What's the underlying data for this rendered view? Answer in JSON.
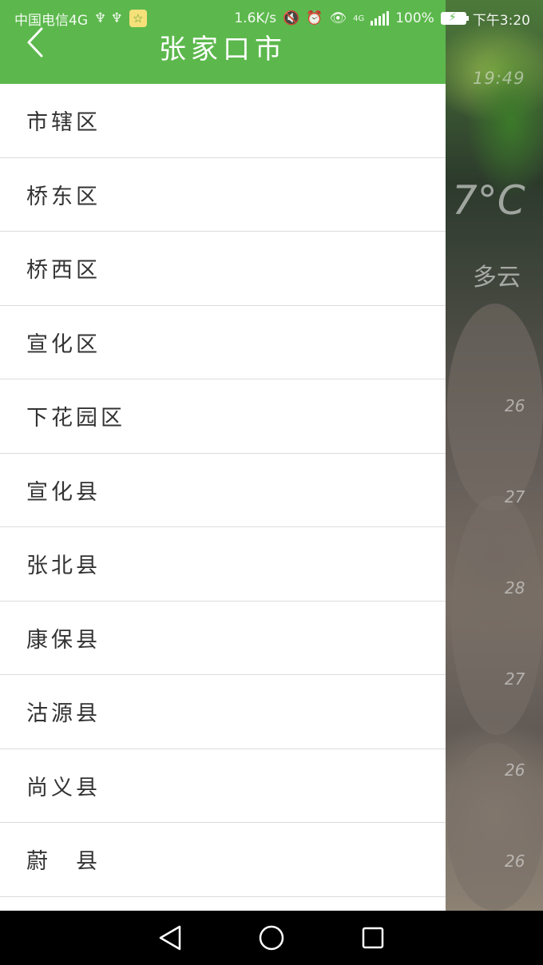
{
  "status_bar": {
    "carrier": "中国电信4G",
    "usb_glyphs": "♆ ♆",
    "badge_glyph": "☆",
    "speed": "1.6K/s",
    "mute_glyph": "🔇",
    "alarm_glyph": "⏰",
    "eye_glyph": "👁",
    "network": "4G",
    "battery_pct": "100%",
    "time": "下午3:20"
  },
  "app_bar": {
    "title": "张家口市"
  },
  "districts": [
    "市辖区",
    "桥东区",
    "桥西区",
    "宣化区",
    "下花园区",
    "宣化县",
    "张北县",
    "康保县",
    "沽源县",
    "尚义县",
    "蔚　县"
  ],
  "background_weather": {
    "time": "19:49",
    "temperature": "7°C",
    "condition": "多云",
    "forecast_temps": [
      "26",
      "27",
      "28",
      "27",
      "26",
      "26"
    ]
  },
  "colors": {
    "accent": "#5cb84c",
    "divider": "#dcdcdc",
    "text": "#333333"
  }
}
